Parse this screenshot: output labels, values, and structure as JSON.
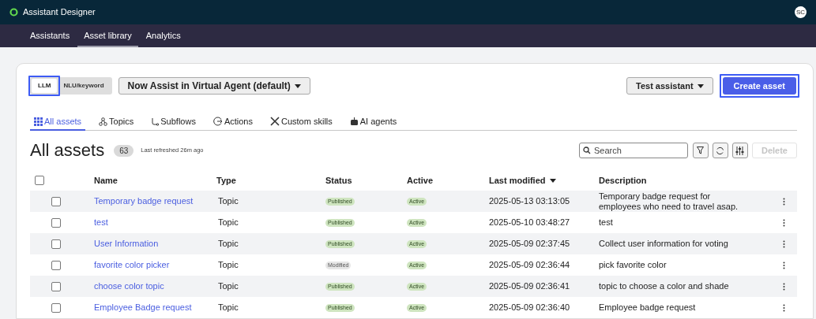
{
  "app": {
    "title": "Assistant Designer",
    "avatar": "SC"
  },
  "nav": [
    {
      "label": "Assistants",
      "selected": false
    },
    {
      "label": "Asset library",
      "selected": true
    },
    {
      "label": "Analytics",
      "selected": false
    }
  ],
  "mode_toggle": [
    {
      "label": "LLM",
      "selected": true,
      "highlighted": true
    },
    {
      "label": "NLU/keyword",
      "selected": false,
      "highlighted": false
    }
  ],
  "assistant_dropdown": "Now Assist in Virtual Agent (default)",
  "test_button": "Test assistant",
  "create_button": {
    "label": "Create asset",
    "highlighted": true
  },
  "tabs": [
    {
      "label": "All assets",
      "kind": "grid",
      "selected": true
    },
    {
      "label": "Topics",
      "kind": "topics",
      "selected": false
    },
    {
      "label": "Subflows",
      "kind": "subflows",
      "selected": false
    },
    {
      "label": "Actions",
      "kind": "actions",
      "selected": false
    },
    {
      "label": "Custom skills",
      "kind": "skills",
      "selected": false
    },
    {
      "label": "AI agents",
      "kind": "agents",
      "selected": false
    }
  ],
  "heading": "All assets",
  "count": "63",
  "refreshed": "Last refreshed 26m ago",
  "search": {
    "placeholder": "Search"
  },
  "delete_button": {
    "label": "Delete",
    "disabled": true
  },
  "table": {
    "all_checked": false,
    "columns": [
      {
        "label": "Name",
        "sorted": false
      },
      {
        "label": "Type",
        "sorted": false
      },
      {
        "label": "Status",
        "sorted": false
      },
      {
        "label": "Active",
        "sorted": false
      },
      {
        "label": "Last modified",
        "sorted": true
      },
      {
        "label": "Description",
        "sorted": false
      }
    ],
    "rows": [
      {
        "checked": false,
        "name": "Temporary badge request",
        "type": "Topic",
        "status": {
          "label": "Published",
          "kind": "published"
        },
        "active": "Active",
        "modified": "2025-05-13 03:13:05",
        "description": "Temporary badge request for employees who need to travel asap."
      },
      {
        "checked": false,
        "name": "test",
        "type": "Topic",
        "status": {
          "label": "Published",
          "kind": "published"
        },
        "active": "Active",
        "modified": "2025-05-10 03:48:27",
        "description": "test"
      },
      {
        "checked": false,
        "name": "User Information",
        "type": "Topic",
        "status": {
          "label": "Published",
          "kind": "published"
        },
        "active": "Active",
        "modified": "2025-05-09 02:37:45",
        "description": "Collect user information for voting"
      },
      {
        "checked": false,
        "name": "favorite color picker",
        "type": "Topic",
        "status": {
          "label": "Modified",
          "kind": "modified"
        },
        "active": "Active",
        "modified": "2025-05-09 02:36:44",
        "description": "pick favorite color"
      },
      {
        "checked": false,
        "name": "choose color topic",
        "type": "Topic",
        "status": {
          "label": "Published",
          "kind": "published"
        },
        "active": "Active",
        "modified": "2025-05-09 02:36:41",
        "description": "topic to choose a color and shade"
      },
      {
        "checked": false,
        "name": "Employee Badge request",
        "type": "Topic",
        "status": {
          "label": "Published",
          "kind": "published"
        },
        "active": "Active",
        "modified": "2025-05-09 02:36:40",
        "description": "Employee badge request"
      }
    ]
  }
}
